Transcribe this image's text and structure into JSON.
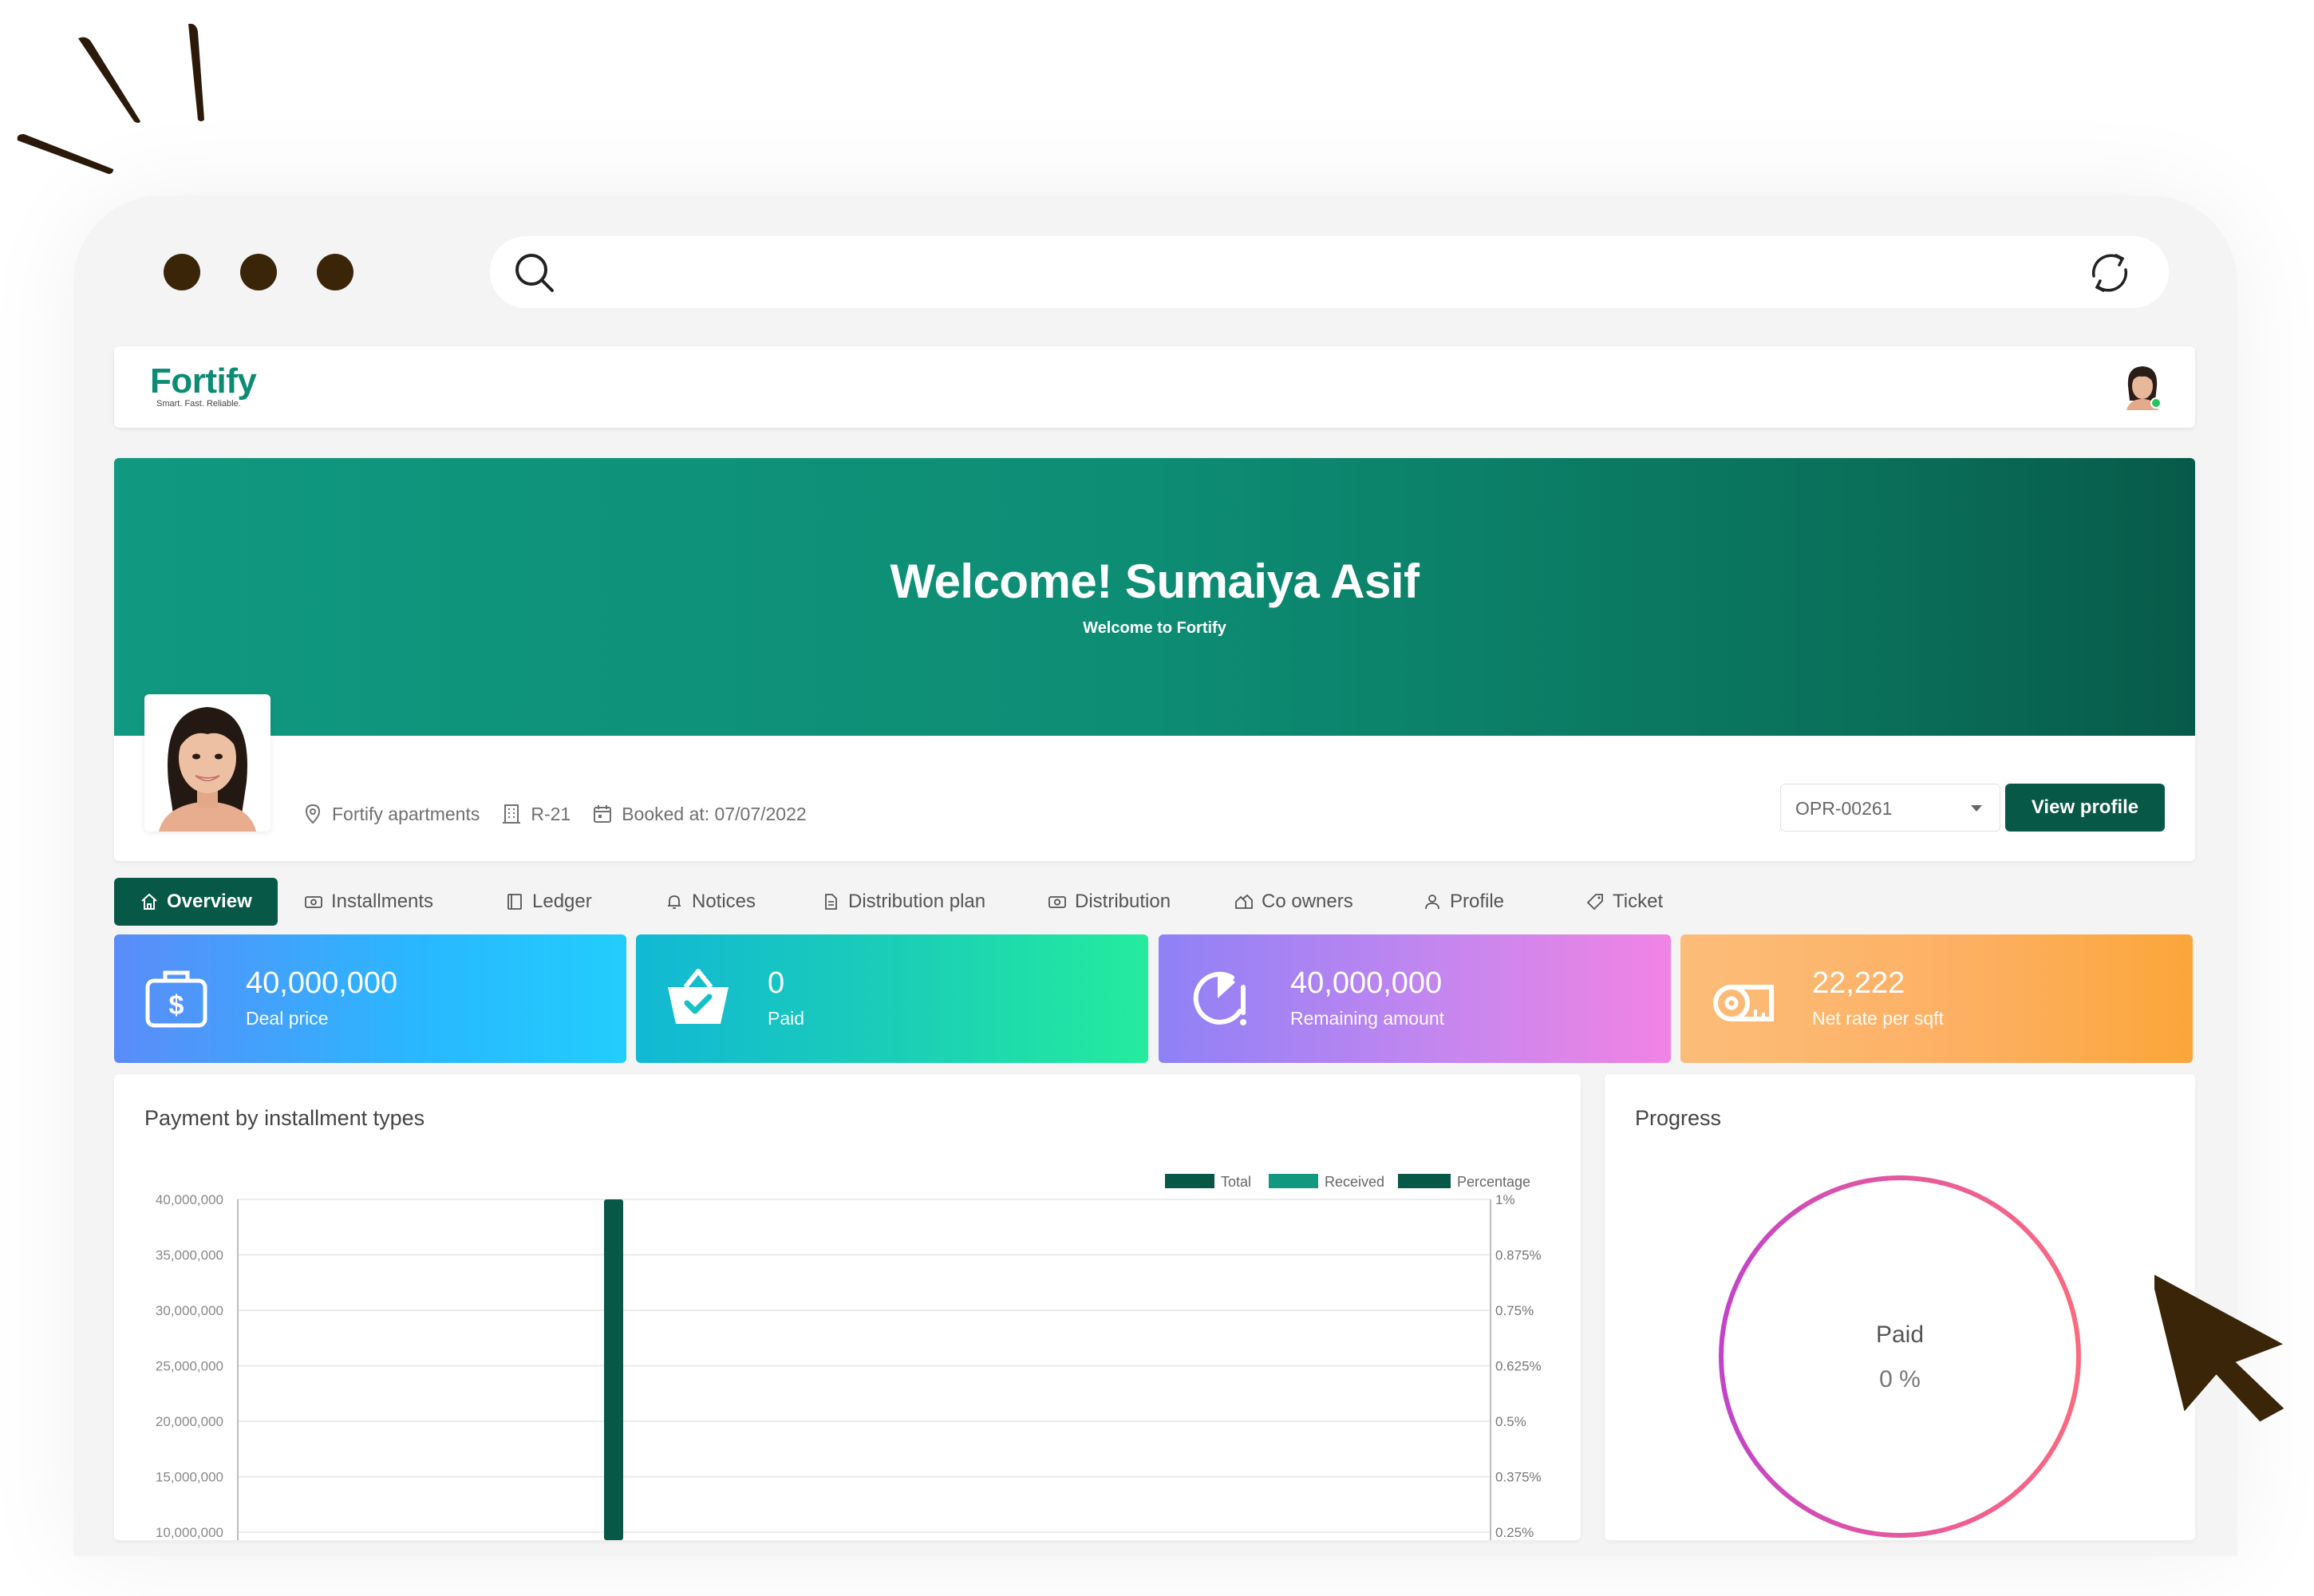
{
  "header": {
    "logo_text": "Fortify",
    "logo_tagline": "Smart. Fast. Reliable."
  },
  "banner": {
    "title": "Welcome! Sumaiya Asif",
    "subtitle": "Welcome to Fortify"
  },
  "profile": {
    "project": "Fortify apartments",
    "unit": "R-21",
    "booked": "Booked at: 07/07/2022",
    "selected_file": "OPR-00261",
    "view_profile_label": "View profile"
  },
  "tabs": [
    {
      "label": "Overview",
      "icon": "home-icon",
      "active": true
    },
    {
      "label": "Installments",
      "icon": "cash-icon",
      "active": false
    },
    {
      "label": "Ledger",
      "icon": "book-icon",
      "active": false
    },
    {
      "label": "Notices",
      "icon": "bell-icon",
      "active": false
    },
    {
      "label": "Distribution plan",
      "icon": "document-icon",
      "active": false
    },
    {
      "label": "Distribution",
      "icon": "camera-icon",
      "active": false
    },
    {
      "label": "Co owners",
      "icon": "houses-icon",
      "active": false
    },
    {
      "label": "Profile",
      "icon": "user-icon",
      "active": false
    },
    {
      "label": "Ticket",
      "icon": "tag-icon",
      "active": false
    }
  ],
  "stats": [
    {
      "value": "40,000,000",
      "label": "Deal price",
      "icon": "money-bag-icon"
    },
    {
      "value": "0",
      "label": "Paid",
      "icon": "basket-check-icon"
    },
    {
      "value": "40,000,000",
      "label": "Remaining amount",
      "icon": "pie-alert-icon"
    },
    {
      "value": "22,222",
      "label": "Net rate per sqft",
      "icon": "measure-tape-icon"
    }
  ],
  "chart_panel": {
    "title": "Payment by installment types"
  },
  "progress_panel": {
    "title": "Progress",
    "center_label": "Paid",
    "center_value": "0 %",
    "percent": 0
  },
  "colors": {
    "primary": "#075846",
    "accent": "#0c8c73",
    "total": "#075846",
    "received": "#12987e",
    "percentage": "#075846"
  },
  "chart_data": {
    "type": "bar",
    "legend": [
      "Total",
      "Received",
      "Percentage"
    ],
    "legend_placement": "top-right",
    "y_left_ticks": [
      "40,000,000",
      "35,000,000",
      "30,000,000",
      "25,000,000",
      "20,000,000",
      "15,000,000",
      "10,000,000"
    ],
    "y_right_ticks": [
      "1%",
      "0.875%",
      "0.75%",
      "0.625%",
      "0.5%",
      "0.375%",
      "0.25%"
    ],
    "ylim_left": [
      0,
      40000000
    ],
    "ylim_right": [
      0,
      1
    ],
    "series": [
      {
        "name": "Total",
        "values": [
          40000000
        ]
      },
      {
        "name": "Received",
        "values": [
          0
        ]
      },
      {
        "name": "Percentage",
        "values": [
          0
        ]
      }
    ]
  }
}
